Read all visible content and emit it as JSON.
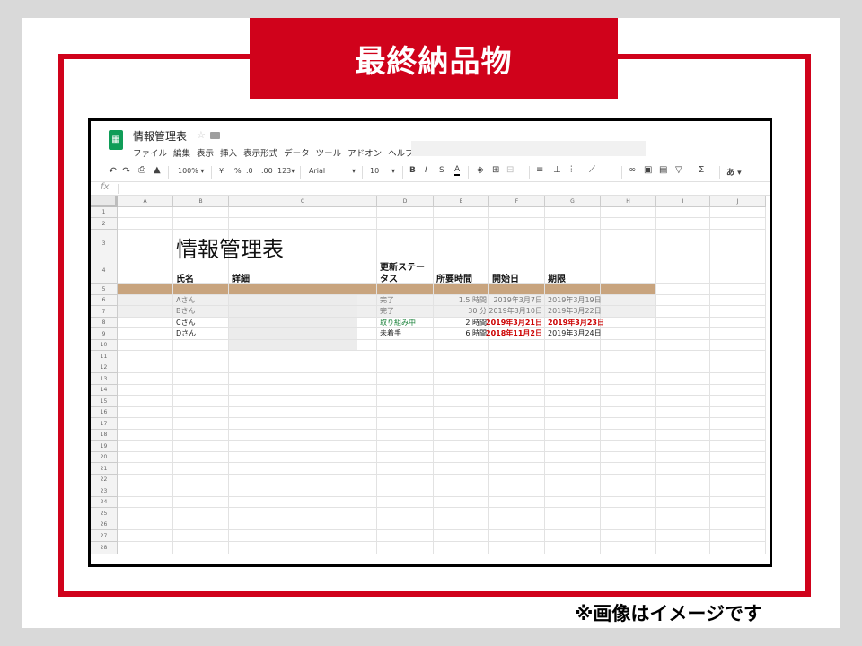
{
  "slide": {
    "title": "最終納品物",
    "note": "※画像はイメージです",
    "accent": "#d0021b"
  },
  "app": {
    "doc_title": "情報管理表",
    "logo_icon": "sheets-logo-icon",
    "menu": [
      "ファイル",
      "編集",
      "表示",
      "挿入",
      "表示形式",
      "データ",
      "ツール",
      "アドオン",
      "ヘルプ"
    ],
    "toolbar": {
      "zoom": "100% ▾",
      "currency": "¥",
      "percent": "%",
      "dec_less": ".0",
      "dec_more": ".00",
      "format": "123▾",
      "font": "Arial",
      "font_caret": "▾",
      "size": "10",
      "size_caret": "▾",
      "bold": "B",
      "italic": "I",
      "strike": "S",
      "text_color": "A",
      "input_tool": "あ ▾",
      "icons": [
        "undo-icon",
        "redo-icon",
        "print-icon",
        "paint-format-icon",
        "fill-color-icon",
        "borders-icon",
        "merge-icon",
        "align-icon",
        "valign-icon",
        "wrap-icon",
        "rotate-icon",
        "link-icon",
        "comment-icon",
        "chart-icon",
        "filter-icon",
        "functions-icon"
      ]
    },
    "formula_bar": {
      "fx": "fx",
      "value": ""
    }
  },
  "sheet": {
    "columns": [
      "A",
      "B",
      "C",
      "D",
      "E",
      "F",
      "G",
      "H",
      "I",
      "J"
    ],
    "rows": [
      "1",
      "2",
      "3",
      "4",
      "5",
      "6",
      "7",
      "8",
      "9",
      "10",
      "11",
      "12",
      "13",
      "14",
      "15",
      "16",
      "17",
      "18",
      "19",
      "20",
      "21",
      "22",
      "23",
      "24",
      "25",
      "26",
      "27",
      "28"
    ],
    "title": "情報管理表",
    "headers": {
      "name": "氏名",
      "detail": "詳細",
      "status_line1": "更新ステー",
      "status_line2": "タス",
      "hours": "所要時間",
      "start": "開始日",
      "deadline": "期限"
    },
    "band_color": "#c8a47e",
    "records": [
      {
        "name": "Aさん",
        "status": "完了",
        "hours": "1.5 時間",
        "start": "2019年3月7日",
        "deadline": "2019年3月19日",
        "status_color": "#777777",
        "date_color": "#777777",
        "dates_bold": false,
        "gray": true
      },
      {
        "name": "Bさん",
        "status": "完了",
        "hours": "30 分",
        "start": "2019年3月10日",
        "deadline": "2019年3月22日",
        "status_color": "#777777",
        "date_color": "#777777",
        "dates_bold": false,
        "gray": true
      },
      {
        "name": "Cさん",
        "status": "取り組み中",
        "hours": "2 時間",
        "start": "2019年3月21日",
        "deadline": "2019年3月23日",
        "status_color": "#188038",
        "date_color": "#cc0000",
        "dates_bold": true,
        "gray": false
      },
      {
        "name": "Dさん",
        "status": "未着手",
        "hours": "6 時間",
        "start": "2018年11月2日",
        "deadline": "2019年3月24日",
        "status_color": "#222222",
        "date_color": "#cc0000",
        "dates_bold": true,
        "gray": false
      }
    ]
  }
}
